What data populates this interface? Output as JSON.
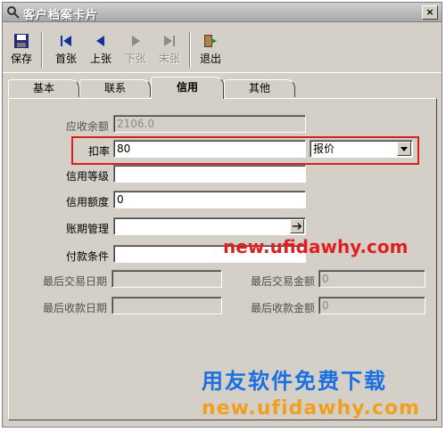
{
  "window": {
    "title": "客户档案卡片",
    "close_label": "×"
  },
  "toolbar": {
    "buttons": [
      {
        "label": "保存",
        "icon": "save-icon"
      },
      {
        "label": "首张",
        "icon": "first-record-icon"
      },
      {
        "label": "上张",
        "icon": "previous-record-icon"
      },
      {
        "label": "下张",
        "icon": "next-record-icon",
        "disabled": true
      },
      {
        "label": "末张",
        "icon": "last-record-icon",
        "disabled": true
      },
      {
        "label": "退出",
        "icon": "exit-icon"
      }
    ]
  },
  "tabs": [
    {
      "label": "基本"
    },
    {
      "label": "联系"
    },
    {
      "label": "信用",
      "active": true
    },
    {
      "label": "其他"
    }
  ],
  "form": {
    "receivable_balance": {
      "label": "应收余额",
      "value": "2106.0"
    },
    "discount_rate": {
      "label": "扣率",
      "value": "80"
    },
    "price_type": {
      "value": "报价"
    },
    "credit_level": {
      "label": "信用等级",
      "value": ""
    },
    "credit_limit": {
      "label": "信用额度",
      "value": "0"
    },
    "account_period": {
      "label": "账期管理",
      "value": ""
    },
    "payment_terms": {
      "label": "付款条件",
      "value": ""
    },
    "last_trade_date": {
      "label": "最后交易日期",
      "value": ""
    },
    "last_trade_amount": {
      "label": "最后交易金额",
      "value": "0"
    },
    "last_receipt_date": {
      "label": "最后收款日期",
      "value": ""
    },
    "last_receipt_amount": {
      "label": "最后收款金额",
      "value": "0"
    }
  },
  "watermarks": {
    "mid": "new.ufidawhy.com",
    "big": "用友软件免费下载",
    "sub": "new.ufidawhy.com"
  },
  "colors": {
    "highlight": "#d82020",
    "watermark_red": "#e02020",
    "watermark_blue": "#1c6fe0",
    "watermark_orange": "#f0a020"
  }
}
